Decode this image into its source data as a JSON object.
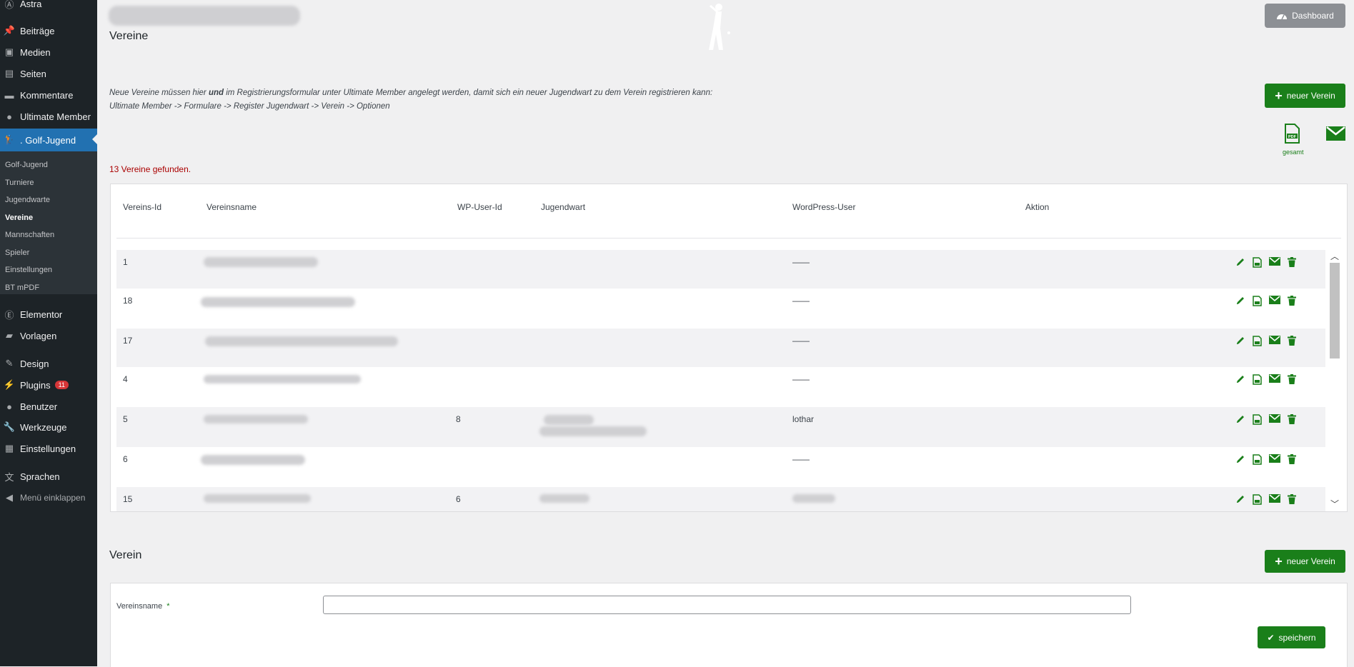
{
  "sidebar": {
    "brand": "Astra",
    "items": [
      {
        "label": "Beiträge",
        "icon": "pin-icon"
      },
      {
        "label": "Medien",
        "icon": "media-icon"
      },
      {
        "label": "Seiten",
        "icon": "pages-icon"
      },
      {
        "label": "Kommentare",
        "icon": "comments-icon"
      },
      {
        "label": "Ultimate Member",
        "icon": "user-icon"
      },
      {
        "label": ". Golf-Jugend",
        "icon": "golfer-icon"
      }
    ],
    "submenu": [
      "Golf-Jugend",
      "Turniere",
      "Jugendwarte",
      "Vereine",
      "Mannschaften",
      "Spieler",
      "Einstellungen",
      "BT mPDF"
    ],
    "items2": [
      {
        "label": "Elementor",
        "icon": "elementor-icon"
      },
      {
        "label": "Vorlagen",
        "icon": "folder-icon"
      },
      {
        "label": "Design",
        "icon": "brush-icon"
      },
      {
        "label": "Plugins",
        "icon": "plugin-icon",
        "badge": "11"
      },
      {
        "label": "Benutzer",
        "icon": "users-icon"
      },
      {
        "label": "Werkzeuge",
        "icon": "wrench-icon"
      },
      {
        "label": "Einstellungen",
        "icon": "settings-icon"
      },
      {
        "label": "Sprachen",
        "icon": "translate-icon"
      }
    ],
    "collapse": "Menü einklappen"
  },
  "header": {
    "title": "Vereine",
    "dashboard": "Dashboard"
  },
  "info": {
    "line1_a": "Neue Vereine müssen hier ",
    "line1_b": "und",
    "line1_c": " im Registrierungsformular unter Ultimate Member angelegt werden, damit sich ein neuer Jugendwart zu dem Verein registrieren kann:",
    "line2": "Ultimate Member -> Formulare -> Register Jugendwart -> Verein -> Optionen"
  },
  "buttons": {
    "new_club": "neuer Verein",
    "pdf_label": "gesamt",
    "save": "speichern"
  },
  "found": "13 Vereine gefunden.",
  "table": {
    "headers": [
      "Vereins-Id",
      "Vereinsname",
      "WP-User-Id",
      "Jugendwart",
      "WordPress-User",
      "Aktion"
    ],
    "rows": [
      {
        "id": "1",
        "wp_user_id": "",
        "wp_user": "——"
      },
      {
        "id": "18",
        "wp_user_id": "",
        "wp_user": "——"
      },
      {
        "id": "17",
        "wp_user_id": "",
        "wp_user": "——"
      },
      {
        "id": "4",
        "wp_user_id": "",
        "wp_user": "——"
      },
      {
        "id": "5",
        "wp_user_id": "8",
        "wp_user": "lothar"
      },
      {
        "id": "6",
        "wp_user_id": "",
        "wp_user": "——"
      },
      {
        "id": "15",
        "wp_user_id": "6",
        "wp_user": ""
      }
    ]
  },
  "form": {
    "title": "Verein",
    "label": "Vereinsname",
    "required": "*",
    "value": ""
  }
}
